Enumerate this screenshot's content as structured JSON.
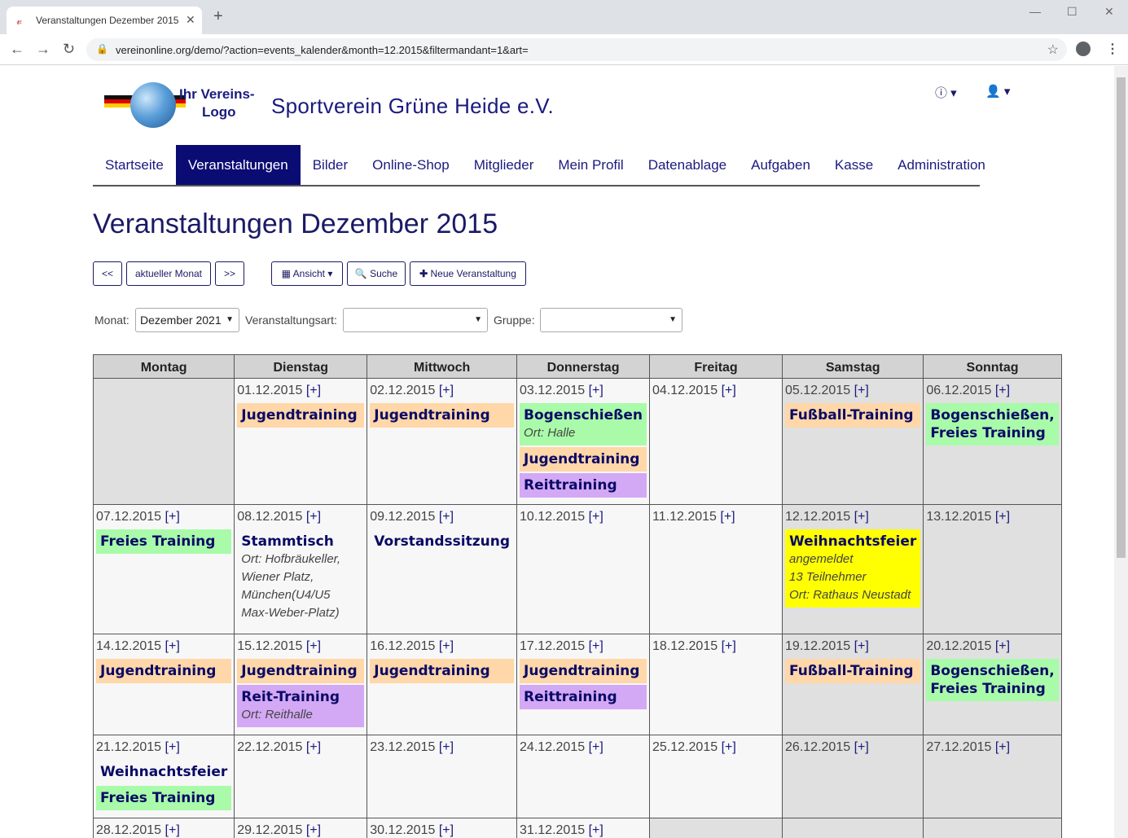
{
  "browser": {
    "tab_title": "Veranstaltungen Dezember 2015",
    "url": "vereinonline.org/demo/?action=events_kalender&month=12.2015&filtermandant=1&art="
  },
  "site": {
    "logo_line1": "Ihr Vereins-",
    "logo_line2": "Logo",
    "title": "Sportverein Grüne Heide e.V."
  },
  "nav": [
    {
      "label": "Startseite"
    },
    {
      "label": "Veranstaltungen",
      "active": true
    },
    {
      "label": "Bilder"
    },
    {
      "label": "Online-Shop"
    },
    {
      "label": "Mitglieder"
    },
    {
      "label": "Mein Profil"
    },
    {
      "label": "Datenablage"
    },
    {
      "label": "Aufgaben"
    },
    {
      "label": "Kasse"
    },
    {
      "label": "Administration"
    }
  ],
  "page_title": "Veranstaltungen Dezember 2015",
  "toolbar": {
    "prev": "<<",
    "current": "aktueller Monat",
    "next": ">>",
    "view": "Ansicht",
    "search": "Suche",
    "new_event": "Neue Veranstaltung"
  },
  "filters": {
    "month_label": "Monat:",
    "month_value": "Dezember 2021",
    "type_label": "Veranstaltungsart:",
    "type_value": "",
    "group_label": "Gruppe:",
    "group_value": ""
  },
  "calendar": {
    "weekdays": [
      "Montag",
      "Dienstag",
      "Mittwoch",
      "Donnerstag",
      "Freitag",
      "Samstag",
      "Sonntag"
    ],
    "add_label": "[+]",
    "weeks": [
      [
        null,
        {
          "date": "01.12.2015",
          "events": [
            {
              "title": "Jugendtraining",
              "color": "orange"
            }
          ]
        },
        {
          "date": "02.12.2015",
          "events": [
            {
              "title": "Jugendtraining",
              "color": "orange"
            }
          ]
        },
        {
          "date": "03.12.2015",
          "events": [
            {
              "title": "Bogenschießen",
              "color": "green",
              "details": [
                "Ort: Halle"
              ]
            },
            {
              "title": "Jugendtraining",
              "color": "orange"
            },
            {
              "title": "Reittraining",
              "color": "purple"
            }
          ]
        },
        {
          "date": "04.12.2015",
          "events": []
        },
        {
          "date": "05.12.2015",
          "events": [
            {
              "title": "Fußball-Training",
              "color": "orange",
              "wrap": true
            }
          ]
        },
        {
          "date": "06.12.2015",
          "events": [
            {
              "title": "Bogenschießen, Freies Training",
              "color": "green",
              "wrap": true
            }
          ]
        }
      ],
      [
        {
          "date": "07.12.2015",
          "events": [
            {
              "title": "Freies Training",
              "color": "green"
            }
          ]
        },
        {
          "date": "08.12.2015",
          "events": [
            {
              "title": "Stammtisch",
              "color": "none",
              "details": [
                "Ort: Hofbräukeller, Wiener Platz, München(U4/U5 Max-Weber-Platz)"
              ]
            }
          ]
        },
        {
          "date": "09.12.2015",
          "events": [
            {
              "title": "Vorstandssitzung",
              "color": "none"
            }
          ]
        },
        {
          "date": "10.12.2015",
          "events": []
        },
        {
          "date": "11.12.2015",
          "events": []
        },
        {
          "date": "12.12.2015",
          "events": [
            {
              "title": "Weihnachtsfeier",
              "color": "yellow",
              "details": [
                "angemeldet",
                "13 Teilnehmer",
                "Ort: Rathaus Neustadt"
              ]
            }
          ]
        },
        {
          "date": "13.12.2015",
          "events": []
        }
      ],
      [
        {
          "date": "14.12.2015",
          "events": [
            {
              "title": "Jugendtraining",
              "color": "orange"
            }
          ]
        },
        {
          "date": "15.12.2015",
          "events": [
            {
              "title": "Jugendtraining",
              "color": "orange"
            },
            {
              "title": "Reit-Training",
              "color": "purple",
              "details": [
                "Ort: Reithalle"
              ]
            }
          ]
        },
        {
          "date": "16.12.2015",
          "events": [
            {
              "title": "Jugendtraining",
              "color": "orange"
            }
          ]
        },
        {
          "date": "17.12.2015",
          "events": [
            {
              "title": "Jugendtraining",
              "color": "orange"
            },
            {
              "title": "Reittraining",
              "color": "purple"
            }
          ]
        },
        {
          "date": "18.12.2015",
          "events": []
        },
        {
          "date": "19.12.2015",
          "events": [
            {
              "title": "Fußball-Training",
              "color": "orange",
              "wrap": true
            }
          ]
        },
        {
          "date": "20.12.2015",
          "events": [
            {
              "title": "Bogenschießen, Freies Training",
              "color": "green",
              "wrap": true
            }
          ]
        }
      ],
      [
        {
          "date": "21.12.2015",
          "events": [
            {
              "title": "Weihnachtsfeier",
              "color": "none"
            },
            {
              "title": "Freies Training",
              "color": "green"
            }
          ]
        },
        {
          "date": "22.12.2015",
          "events": []
        },
        {
          "date": "23.12.2015",
          "events": []
        },
        {
          "date": "24.12.2015",
          "events": []
        },
        {
          "date": "25.12.2015",
          "events": []
        },
        {
          "date": "26.12.2015",
          "events": []
        },
        {
          "date": "27.12.2015",
          "events": []
        }
      ],
      [
        {
          "date": "28.12.2015",
          "events": []
        },
        {
          "date": "29.12.2015",
          "events": []
        },
        {
          "date": "30.12.2015",
          "events": []
        },
        {
          "date": "31.12.2015",
          "events": []
        },
        null,
        null,
        null
      ]
    ]
  }
}
